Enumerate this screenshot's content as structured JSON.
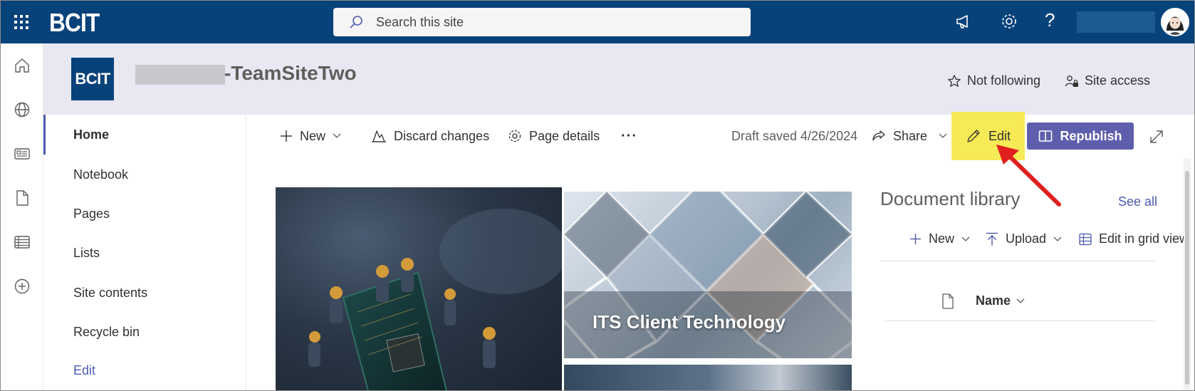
{
  "suite": {
    "brand": "BCIT",
    "search_placeholder": "Search this site"
  },
  "site": {
    "logo_text": "BCIT",
    "title": "-TeamSiteTwo",
    "not_following": "Not following",
    "site_access": "Site access"
  },
  "nav": {
    "items": [
      "Home",
      "Notebook",
      "Pages",
      "Lists",
      "Site contents",
      "Recycle bin"
    ],
    "edit_link": "Edit"
  },
  "commandbar": {
    "new": "New",
    "discard": "Discard changes",
    "page_details": "Page details",
    "more": "···",
    "draft_status": "Draft saved 4/26/2024",
    "share": "Share",
    "edit": "Edit",
    "republish": "Republish"
  },
  "hero": {
    "tile2_caption": "ITS Client Technology"
  },
  "doclib": {
    "title": "Document library",
    "see_all": "See all",
    "new": "New",
    "upload": "Upload",
    "edit_grid": "Edit in grid view",
    "column_name": "Name"
  },
  "colors": {
    "suitebar": "#07427a",
    "accent": "#4e5baf",
    "republish": "#5e5fac",
    "highlight": "#f6ea56",
    "arrow": "#e02020"
  }
}
